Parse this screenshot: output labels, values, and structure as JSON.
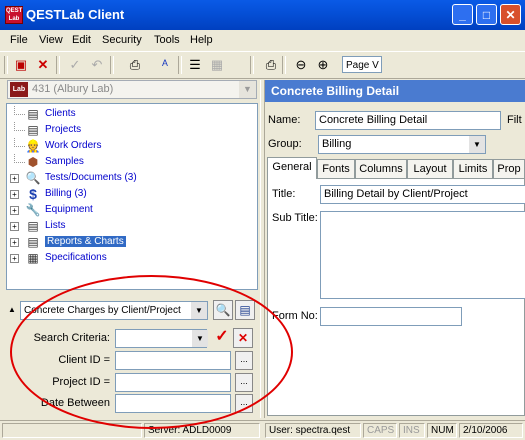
{
  "window": {
    "title": "QESTLab Client",
    "logo": "QEST Lab"
  },
  "window_buttons": [
    "_",
    "□",
    "✕"
  ],
  "menu": [
    "File",
    "View",
    "Edit",
    "Security",
    "Tools",
    "Help"
  ],
  "toolbar": {
    "page_view_value": "Page V"
  },
  "lab_selector": {
    "logo": "Lab",
    "value": "431 (Albury Lab)"
  },
  "tree": {
    "nodes": [
      {
        "label": "Clients",
        "icon": "document-icon",
        "glyph": "▤",
        "expandable": false,
        "selected": false
      },
      {
        "label": "Projects",
        "icon": "document-icon",
        "glyph": "▤",
        "expandable": false,
        "selected": false
      },
      {
        "label": "Work Orders",
        "icon": "worker-icon",
        "glyph": "👷",
        "expandable": false,
        "selected": false
      },
      {
        "label": "Samples",
        "icon": "samples-icon",
        "glyph": "⬢",
        "expandable": false,
        "selected": false
      },
      {
        "label": "Tests/Documents (3)",
        "icon": "tests-icon",
        "glyph": "🔍",
        "expandable": true,
        "selected": false
      },
      {
        "label": "Billing (3)",
        "icon": "dollar-icon",
        "glyph": "$",
        "expandable": true,
        "selected": false
      },
      {
        "label": "Equipment",
        "icon": "tools-icon",
        "glyph": "🔧",
        "expandable": true,
        "selected": false
      },
      {
        "label": "Lists",
        "icon": "document-icon",
        "glyph": "▤",
        "expandable": true,
        "selected": false
      },
      {
        "label": "Reports & Charts",
        "icon": "reports-icon",
        "glyph": "▤",
        "expandable": true,
        "selected": true
      },
      {
        "label": "Specifications",
        "icon": "specs-icon",
        "glyph": "▦",
        "expandable": true,
        "selected": false
      }
    ]
  },
  "search": {
    "report_selector_value": "Concrete Charges by Client/Project",
    "criteria_label": "Search Criteria:",
    "criteria_value": "",
    "client_id_label": "Client ID =",
    "client_id_value": "",
    "project_id_label": "Project ID =",
    "project_id_value": "",
    "date_between_label": "Date Between",
    "date_between_value": "",
    "ellipsis": "..."
  },
  "detail": {
    "header": "Concrete Billing Detail",
    "name_label": "Name:",
    "name_value": "Concrete Billing Detail",
    "filter_label": "Filt",
    "group_label": "Group:",
    "group_value": "Billing",
    "tabs": [
      "General",
      "Fonts",
      "Columns",
      "Layout",
      "Limits",
      "Prop"
    ],
    "title_label": "Title:",
    "title_value": "Billing Detail by Client/Project",
    "subtitle_label": "Sub Title:",
    "subtitle_value": "",
    "form_no_label": "Form No:",
    "form_no_value": ""
  },
  "status": {
    "server": "Server: ADLD0009",
    "user": "User: spectra.qest",
    "caps": "CAPS",
    "ins": "INS",
    "num": "NUM",
    "date": "2/10/2006"
  },
  "colors": {
    "accent": "#4a7bd0",
    "selection": "#316ac5",
    "annotation_circle": "#e00000"
  }
}
